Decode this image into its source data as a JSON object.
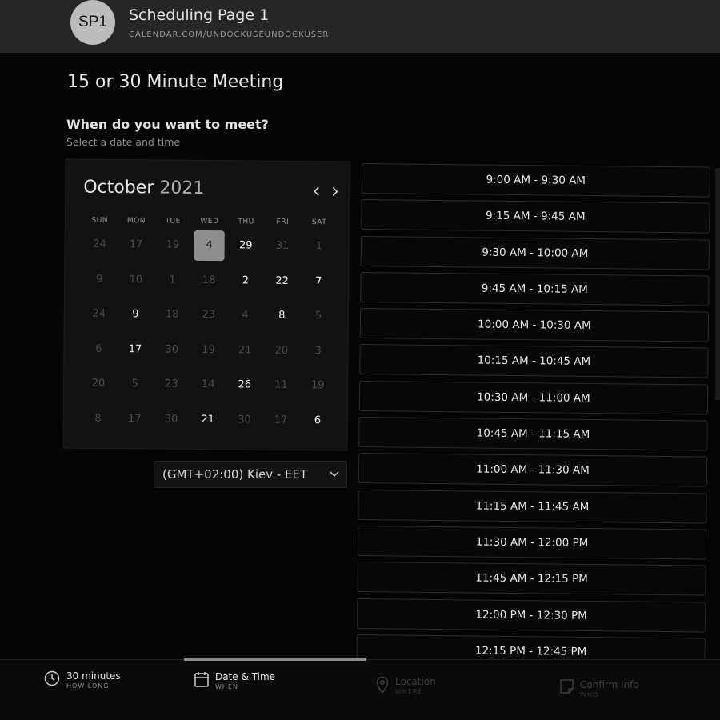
{
  "header": {
    "avatar_initials": "SP1",
    "page_name": "Scheduling Page 1",
    "page_url": "CALENDAR.COM/UNDOCKUSEUNDOCKUSER"
  },
  "meeting_title": "15 or 30 Minute Meeting",
  "prompt": {
    "question": "When do you want to meet?",
    "sub": "Select a date and time"
  },
  "calendar": {
    "month": "October",
    "year": "2021",
    "days_of_week": [
      "SUN",
      "MON",
      "TUE",
      "WED",
      "THU",
      "FRI",
      "SAT"
    ],
    "weeks": [
      [
        {
          "d": "24",
          "s": "dim"
        },
        {
          "d": "17",
          "s": "dim"
        },
        {
          "d": "19",
          "s": "dim"
        },
        {
          "d": "4",
          "s": "selected"
        },
        {
          "d": "29",
          "s": "avail"
        },
        {
          "d": "31",
          "s": "dim"
        },
        {
          "d": "1",
          "s": "dim"
        }
      ],
      [
        {
          "d": "9",
          "s": "dim"
        },
        {
          "d": "10",
          "s": "dim"
        },
        {
          "d": "1",
          "s": "dim"
        },
        {
          "d": "18",
          "s": "dim"
        },
        {
          "d": "2",
          "s": "avail"
        },
        {
          "d": "22",
          "s": "avail"
        },
        {
          "d": "7",
          "s": "avail"
        }
      ],
      [
        {
          "d": "24",
          "s": "dim"
        },
        {
          "d": "9",
          "s": "avail"
        },
        {
          "d": "18",
          "s": "dim"
        },
        {
          "d": "23",
          "s": "dim"
        },
        {
          "d": "4",
          "s": "dim"
        },
        {
          "d": "8",
          "s": "avail"
        },
        {
          "d": "5",
          "s": "dim"
        }
      ],
      [
        {
          "d": "6",
          "s": "dim"
        },
        {
          "d": "17",
          "s": "avail"
        },
        {
          "d": "30",
          "s": "dim"
        },
        {
          "d": "19",
          "s": "dim"
        },
        {
          "d": "21",
          "s": "dim"
        },
        {
          "d": "20",
          "s": "dim"
        },
        {
          "d": "3",
          "s": "dim"
        }
      ],
      [
        {
          "d": "20",
          "s": "dim"
        },
        {
          "d": "5",
          "s": "dim"
        },
        {
          "d": "23",
          "s": "dim"
        },
        {
          "d": "14",
          "s": "dim"
        },
        {
          "d": "26",
          "s": "avail"
        },
        {
          "d": "11",
          "s": "dim"
        },
        {
          "d": "19",
          "s": "dim"
        }
      ],
      [
        {
          "d": "8",
          "s": "dim"
        },
        {
          "d": "17",
          "s": "dim"
        },
        {
          "d": "30",
          "s": "dim"
        },
        {
          "d": "21",
          "s": "avail"
        },
        {
          "d": "30",
          "s": "dim"
        },
        {
          "d": "17",
          "s": "dim"
        },
        {
          "d": "6",
          "s": "avail"
        }
      ]
    ]
  },
  "timezone": {
    "value": "(GMT+02:00) Kiev - EET"
  },
  "time_slots": [
    "9:00 AM - 9:30 AM",
    "9:15 AM - 9:45 AM",
    "9:30 AM - 10:00 AM",
    "9:45 AM - 10:15 AM",
    "10:00 AM - 10:30 AM",
    "10:15 AM - 10:45 AM",
    "10:30 AM - 11:00 AM",
    "10:45 AM - 11:15 AM",
    "11:00 AM - 11:30 AM",
    "11:15 AM - 11:45 AM",
    "11:30 AM - 12:00 PM",
    "11:45 AM - 12:15 PM",
    "12:00 PM - 12:30 PM",
    "12:15 PM - 12:45 PM"
  ],
  "steps": [
    {
      "main": "30 minutes",
      "sub": "HOW LONG",
      "icon": "clock-icon",
      "state": "on"
    },
    {
      "main": "Date & Time",
      "sub": "WHEN",
      "icon": "calendar-icon",
      "state": "on"
    },
    {
      "main": "Location",
      "sub": "WHERE",
      "icon": "location-pin-icon",
      "state": "off"
    },
    {
      "main": "Confirm Info",
      "sub": "WHO",
      "icon": "note-icon",
      "state": "off"
    }
  ]
}
